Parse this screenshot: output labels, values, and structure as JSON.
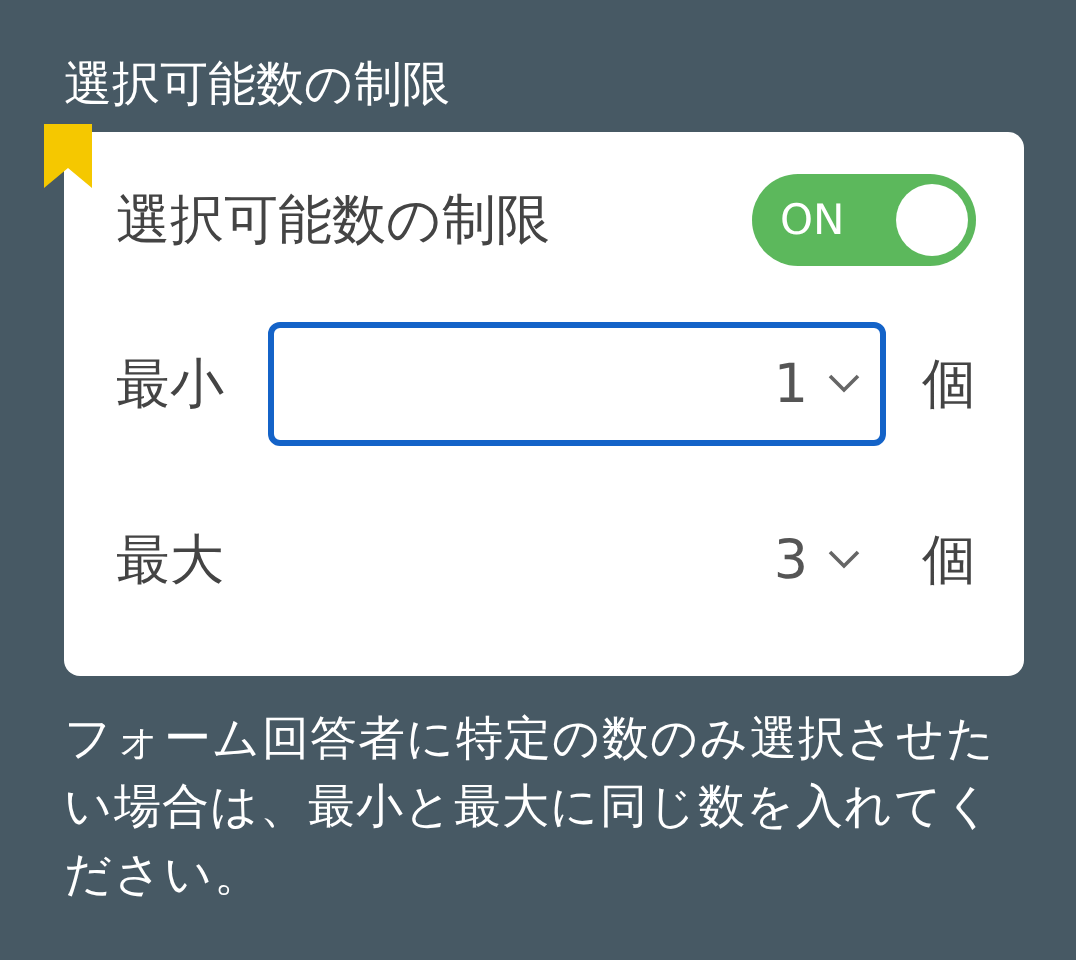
{
  "section_title": "選択可能数の制限",
  "card": {
    "bookmarked": true,
    "toggle": {
      "label": "選択可能数の制限",
      "state_text": "ON",
      "on": true
    },
    "fields": [
      {
        "label": "最小",
        "value": "1",
        "unit": "個",
        "focused": true
      },
      {
        "label": "最大",
        "value": "3",
        "unit": "個",
        "focused": false
      }
    ]
  },
  "help_text": "フォーム回答者に特定の数のみ選択させたい場合は、最小と最大に同じ数を入れてください。"
}
